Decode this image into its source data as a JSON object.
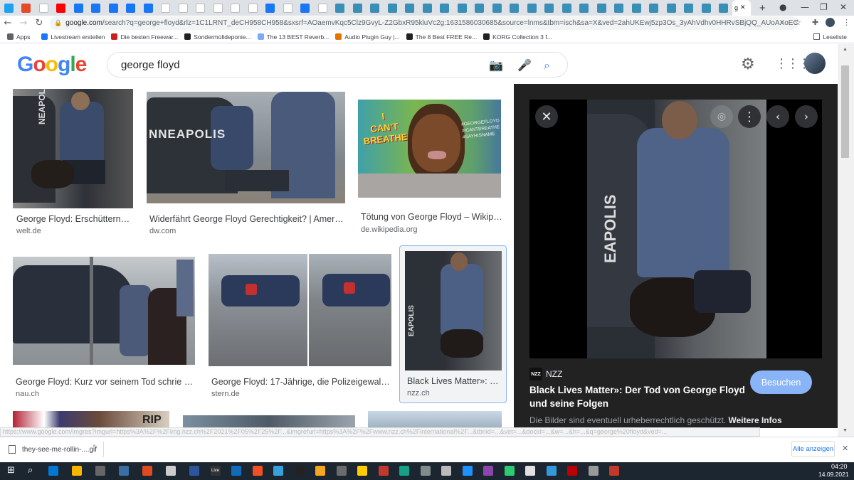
{
  "browser": {
    "tabs_count": 42,
    "active_tab_label": "g",
    "url_host": "google.com",
    "url_rest": "/search?q=george+floyd&rlz=1C1LRNT_deCH958CH958&sxsrf=AOaemvKqc5Clz9GvyL-Z2GbxR95kluVc2g:1631586030685&source=lnms&tbm=isch&sa=X&ved=2ahUKEwj5zp3Os_3yAhVdhv0HHRvSBjQQ_AUoAXoECAEQAw&biw=1280&bih=587...",
    "bookmarks": [
      {
        "label": "Apps",
        "color": "#5f6368"
      },
      {
        "label": "Livestream erstellen",
        "color": "#1877f2"
      },
      {
        "label": "Die besten Freewar...",
        "color": "#c5221f"
      },
      {
        "label": "Sondermülldeponie...",
        "color": "#202124"
      },
      {
        "label": "The 13 BEST Reverb...",
        "color": "#7baaf7"
      },
      {
        "label": "Audio Plugin Guy |...",
        "color": "#e37400"
      },
      {
        "label": "The 8 Best FREE Re...",
        "color": "#202124"
      },
      {
        "label": "KORG Collection 3 f...",
        "color": "#202124"
      }
    ],
    "reading_list": "Leseliste"
  },
  "search": {
    "query": "george floyd",
    "logo": "Google"
  },
  "results": [
    {
      "title": "George Floyd: Erschütternde ...",
      "source": "welt.de"
    },
    {
      "title": "Widerfährt George Floyd Gerechtigkeit? | Amerika -...",
      "source": "dw.com"
    },
    {
      "title": "Tötung von George Floyd – Wikipedia",
      "source": "de.wikipedia.org"
    },
    {
      "title": "George Floyd: Kurz vor seinem Tod schrie er n...",
      "source": "nau.ch"
    },
    {
      "title": "George Floyd: 17-Jährige, die Polizeigewalt an...",
      "source": "stern.de"
    },
    {
      "title": "Black Lives Matter»: De...",
      "source": "nzz.ch"
    }
  ],
  "mural_text": [
    "I",
    "CAN'T",
    "BREATHE"
  ],
  "mural_tags": [
    "#GEORGEFLOYD",
    "#ICANTBREATHE",
    "#SAYHISNAME"
  ],
  "row3_text": "RIP",
  "panel": {
    "source_logo": "NZZ",
    "source_name": "NZZ",
    "title_line1": "Black Lives Matter»: Der Tod von George Floyd",
    "title_line2": "und seine Folgen",
    "visit_label": "Besuchen",
    "copyright_text": "Die Bilder sind eventuell urheberrechtlich geschützt.",
    "more_info": "Weitere Infos",
    "image_text": "EAPOLIS"
  },
  "downloads": {
    "file": "they-see-me-rollin-....gif",
    "show_all": "Alle anzeigen"
  },
  "taskbar": {
    "time": "04:20",
    "date": "14.09.2021",
    "live_label": "Live"
  },
  "colors": {
    "google_blue": "#4285f4",
    "google_red": "#ea4335",
    "google_yellow": "#fbbc05",
    "google_green": "#34a853",
    "panel_bg": "#222222",
    "visit_btn": "#8ab4f8"
  }
}
